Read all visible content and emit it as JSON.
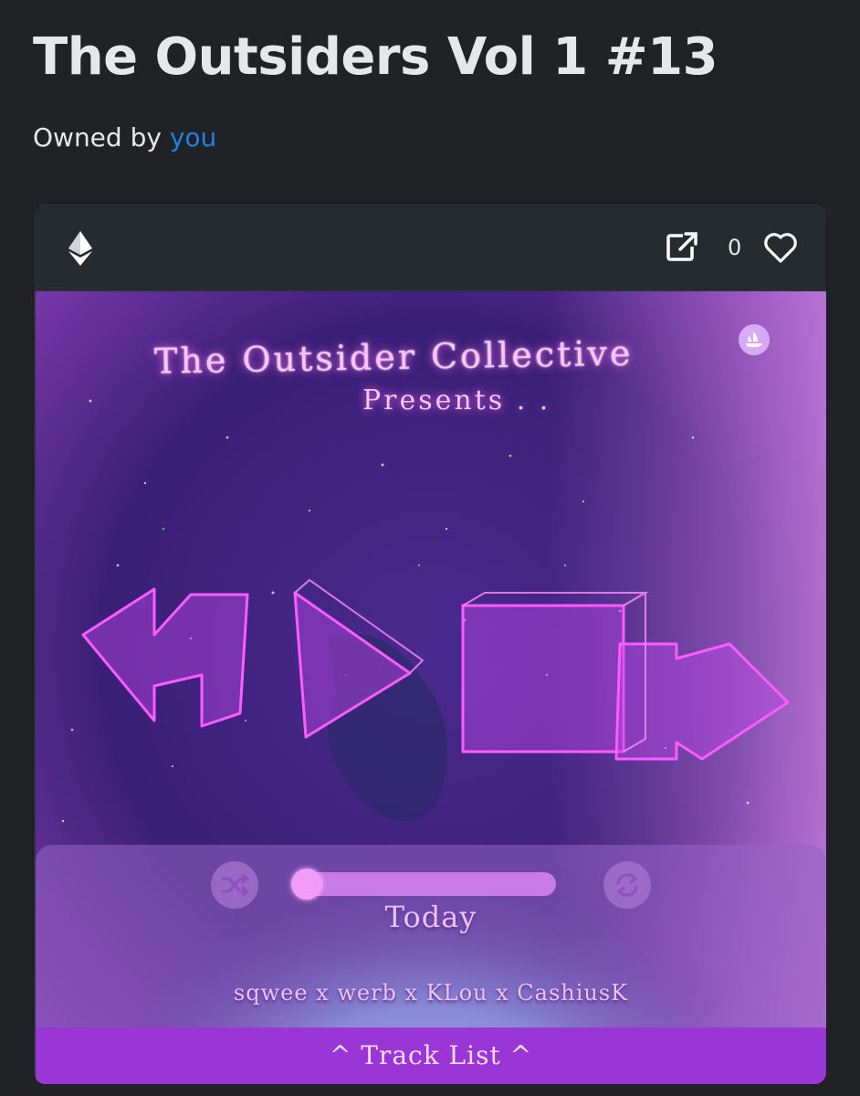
{
  "page": {
    "title": "The Outsiders Vol 1 #13",
    "owned_by_prefix": "Owned by ",
    "owner": "you"
  },
  "card": {
    "favorites_count": "0",
    "icons": [
      "ethereum-icon",
      "external-link-icon",
      "heart-icon"
    ]
  },
  "artwork": {
    "header_line1": "The Outsider Collective",
    "header_line2": "Presents . .",
    "player": {
      "song_title": "Today",
      "artists": "sqwee x werb x KLou x CashiusK",
      "progress": 0.0,
      "tracklist_label": "^ Track List ^"
    },
    "colors": {
      "accent_pink": "#f29cf9",
      "tracklist_bar": "#9b36d6",
      "link_blue": "#2081e2"
    }
  }
}
